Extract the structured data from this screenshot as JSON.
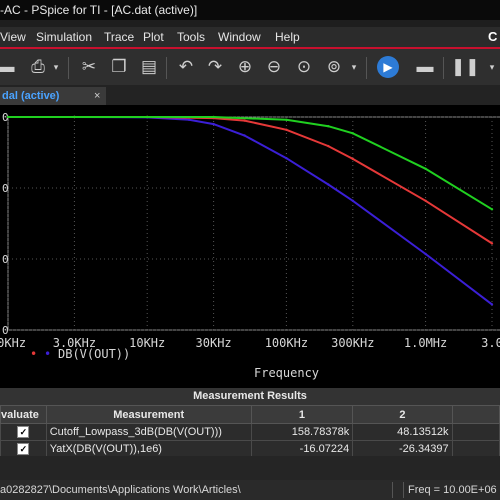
{
  "window": {
    "title": "-AC - PSpice for TI - [AC.dat (active)]"
  },
  "menu": {
    "items": [
      "View",
      "Simulation",
      "Trace",
      "Plot",
      "Tools",
      "Window",
      "Help"
    ],
    "brand": "C"
  },
  "toolbar": {
    "icons": [
      "save-icon",
      "print-icon",
      "dropdown-icon",
      "cut-icon",
      "copy-icon",
      "paste-icon",
      "undo-icon",
      "redo-icon",
      "zoom-in-icon",
      "zoom-out-icon",
      "zoom-fit-icon",
      "zoom-area-icon",
      "dropdown-icon",
      "run-icon",
      "save-data-icon",
      "pause-icon",
      "dropdown-icon"
    ]
  },
  "tab": {
    "label": "dal (active)",
    "close": "×"
  },
  "plot": {
    "x_ticks": [
      ".0KHz",
      "3.0KHz",
      "10KHz",
      "30KHz",
      "100KHz",
      "300KHz",
      "1.0MHz",
      "3.0"
    ],
    "y_ticks": [
      "0",
      "0",
      "0",
      "0"
    ],
    "xlabel": "Frequency",
    "bg": "#000000",
    "grid_color": "#555555"
  },
  "chart_data": {
    "type": "line",
    "xlabel": "Frequency",
    "xscale": "log",
    "series": [
      {
        "name": "DB(V(OUT))",
        "color": "#3b1fd6",
        "x": [
          1000,
          3000,
          10000,
          20000,
          30000,
          50000,
          100000,
          200000,
          300000,
          1000000,
          3000000
        ],
        "y": [
          0,
          0,
          -0.05,
          -0.4,
          -1.0,
          -2.6,
          -5.8,
          -9.5,
          -11.8,
          -19.3,
          -26.4
        ]
      },
      {
        "color": "#e53838",
        "x": [
          1000,
          3000,
          10000,
          30000,
          50000,
          100000,
          200000,
          300000,
          1000000,
          3000000
        ],
        "y": [
          0,
          0,
          0,
          -0.15,
          -0.5,
          -1.8,
          -4.1,
          -5.9,
          -11.8,
          -17.8
        ]
      },
      {
        "color": "#20d020",
        "x": [
          1000,
          3000,
          10000,
          30000,
          100000,
          200000,
          300000,
          1000000,
          3000000
        ],
        "y": [
          0,
          0,
          0,
          0,
          -0.4,
          -1.3,
          -2.3,
          -7.3,
          -13.0
        ]
      }
    ]
  },
  "legend": {
    "items": [
      {
        "marker": "•",
        "color": "#e53838"
      },
      {
        "marker": "•",
        "color": "#3b1fd6",
        "label": "DB(V(OUT))"
      }
    ]
  },
  "measurements": {
    "title": "Measurement Results",
    "headers": [
      "valuate",
      "Measurement",
      "1",
      "2"
    ],
    "rows": [
      {
        "checked": "✓",
        "measurement": "Cutoff_Lowpass_3dB(DB(V(OUT)))",
        "v1": "158.78378k",
        "v2": "48.13512k"
      },
      {
        "checked": "✓",
        "measurement": "YatX(DB(V(OUT)),1e6)",
        "v1": "-16.07224",
        "v2": "-26.34397"
      }
    ]
  },
  "status": {
    "path": "a0282827\\Documents\\Applications Work\\Articles\\",
    "freq": "Freq = 10.00E+06"
  }
}
